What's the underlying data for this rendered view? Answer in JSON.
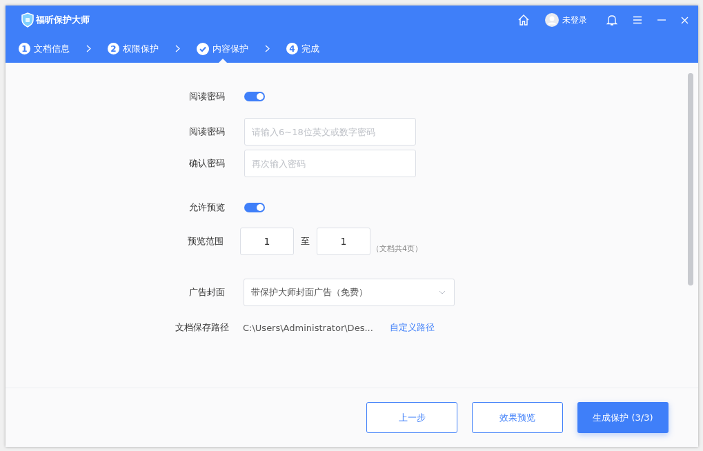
{
  "window": {
    "title": "福昕保护大师",
    "user": "未登录"
  },
  "steps": [
    {
      "kind": "number",
      "number": "1",
      "label": "文档信息",
      "selected": false
    },
    {
      "kind": "number",
      "number": "2",
      "label": "权限保护",
      "selected": false
    },
    {
      "kind": "check",
      "label": "内容保护",
      "selected": true
    },
    {
      "kind": "number",
      "number": "4",
      "label": "完成",
      "selected": false
    }
  ],
  "form": {
    "read_password_toggle": {
      "label": "阅读密码",
      "on": true
    },
    "password": {
      "label": "阅读密码",
      "placeholder": "请输入6~18位英文或数字密码"
    },
    "confirm": {
      "label": "确认密码",
      "placeholder": "再次输入密码"
    },
    "preview_toggle": {
      "label": "允许预览",
      "on": true
    },
    "range": {
      "label": "预览范围",
      "from": "1",
      "separator": "至",
      "to": "1",
      "note": "（文档共4页）"
    },
    "cover": {
      "label": "广告封面",
      "value": "带保护大师封面广告（免费）"
    },
    "path": {
      "label": "文档保存路径",
      "value": "C:\\Users\\Administrator\\Des...",
      "link": "自定义路径"
    }
  },
  "buttons": [
    {
      "kind": "outline",
      "label": "上一步"
    },
    {
      "kind": "outline",
      "label": "效果预览"
    },
    {
      "kind": "primary",
      "label": "生成保护 (3/3)"
    }
  ]
}
